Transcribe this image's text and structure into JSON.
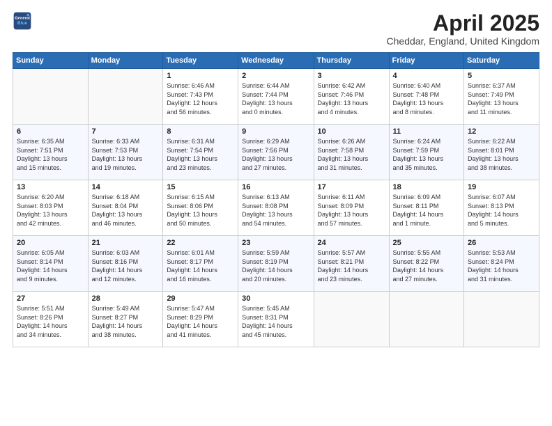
{
  "header": {
    "logo_line1": "General",
    "logo_line2": "Blue",
    "month_title": "April 2025",
    "location": "Cheddar, England, United Kingdom"
  },
  "days_of_week": [
    "Sunday",
    "Monday",
    "Tuesday",
    "Wednesday",
    "Thursday",
    "Friday",
    "Saturday"
  ],
  "weeks": [
    [
      {
        "day": "",
        "info": ""
      },
      {
        "day": "",
        "info": ""
      },
      {
        "day": "1",
        "info": "Sunrise: 6:46 AM\nSunset: 7:43 PM\nDaylight: 12 hours\nand 56 minutes."
      },
      {
        "day": "2",
        "info": "Sunrise: 6:44 AM\nSunset: 7:44 PM\nDaylight: 13 hours\nand 0 minutes."
      },
      {
        "day": "3",
        "info": "Sunrise: 6:42 AM\nSunset: 7:46 PM\nDaylight: 13 hours\nand 4 minutes."
      },
      {
        "day": "4",
        "info": "Sunrise: 6:40 AM\nSunset: 7:48 PM\nDaylight: 13 hours\nand 8 minutes."
      },
      {
        "day": "5",
        "info": "Sunrise: 6:37 AM\nSunset: 7:49 PM\nDaylight: 13 hours\nand 11 minutes."
      }
    ],
    [
      {
        "day": "6",
        "info": "Sunrise: 6:35 AM\nSunset: 7:51 PM\nDaylight: 13 hours\nand 15 minutes."
      },
      {
        "day": "7",
        "info": "Sunrise: 6:33 AM\nSunset: 7:53 PM\nDaylight: 13 hours\nand 19 minutes."
      },
      {
        "day": "8",
        "info": "Sunrise: 6:31 AM\nSunset: 7:54 PM\nDaylight: 13 hours\nand 23 minutes."
      },
      {
        "day": "9",
        "info": "Sunrise: 6:29 AM\nSunset: 7:56 PM\nDaylight: 13 hours\nand 27 minutes."
      },
      {
        "day": "10",
        "info": "Sunrise: 6:26 AM\nSunset: 7:58 PM\nDaylight: 13 hours\nand 31 minutes."
      },
      {
        "day": "11",
        "info": "Sunrise: 6:24 AM\nSunset: 7:59 PM\nDaylight: 13 hours\nand 35 minutes."
      },
      {
        "day": "12",
        "info": "Sunrise: 6:22 AM\nSunset: 8:01 PM\nDaylight: 13 hours\nand 38 minutes."
      }
    ],
    [
      {
        "day": "13",
        "info": "Sunrise: 6:20 AM\nSunset: 8:03 PM\nDaylight: 13 hours\nand 42 minutes."
      },
      {
        "day": "14",
        "info": "Sunrise: 6:18 AM\nSunset: 8:04 PM\nDaylight: 13 hours\nand 46 minutes."
      },
      {
        "day": "15",
        "info": "Sunrise: 6:15 AM\nSunset: 8:06 PM\nDaylight: 13 hours\nand 50 minutes."
      },
      {
        "day": "16",
        "info": "Sunrise: 6:13 AM\nSunset: 8:08 PM\nDaylight: 13 hours\nand 54 minutes."
      },
      {
        "day": "17",
        "info": "Sunrise: 6:11 AM\nSunset: 8:09 PM\nDaylight: 13 hours\nand 57 minutes."
      },
      {
        "day": "18",
        "info": "Sunrise: 6:09 AM\nSunset: 8:11 PM\nDaylight: 14 hours\nand 1 minute."
      },
      {
        "day": "19",
        "info": "Sunrise: 6:07 AM\nSunset: 8:13 PM\nDaylight: 14 hours\nand 5 minutes."
      }
    ],
    [
      {
        "day": "20",
        "info": "Sunrise: 6:05 AM\nSunset: 8:14 PM\nDaylight: 14 hours\nand 9 minutes."
      },
      {
        "day": "21",
        "info": "Sunrise: 6:03 AM\nSunset: 8:16 PM\nDaylight: 14 hours\nand 12 minutes."
      },
      {
        "day": "22",
        "info": "Sunrise: 6:01 AM\nSunset: 8:17 PM\nDaylight: 14 hours\nand 16 minutes."
      },
      {
        "day": "23",
        "info": "Sunrise: 5:59 AM\nSunset: 8:19 PM\nDaylight: 14 hours\nand 20 minutes."
      },
      {
        "day": "24",
        "info": "Sunrise: 5:57 AM\nSunset: 8:21 PM\nDaylight: 14 hours\nand 23 minutes."
      },
      {
        "day": "25",
        "info": "Sunrise: 5:55 AM\nSunset: 8:22 PM\nDaylight: 14 hours\nand 27 minutes."
      },
      {
        "day": "26",
        "info": "Sunrise: 5:53 AM\nSunset: 8:24 PM\nDaylight: 14 hours\nand 31 minutes."
      }
    ],
    [
      {
        "day": "27",
        "info": "Sunrise: 5:51 AM\nSunset: 8:26 PM\nDaylight: 14 hours\nand 34 minutes."
      },
      {
        "day": "28",
        "info": "Sunrise: 5:49 AM\nSunset: 8:27 PM\nDaylight: 14 hours\nand 38 minutes."
      },
      {
        "day": "29",
        "info": "Sunrise: 5:47 AM\nSunset: 8:29 PM\nDaylight: 14 hours\nand 41 minutes."
      },
      {
        "day": "30",
        "info": "Sunrise: 5:45 AM\nSunset: 8:31 PM\nDaylight: 14 hours\nand 45 minutes."
      },
      {
        "day": "",
        "info": ""
      },
      {
        "day": "",
        "info": ""
      },
      {
        "day": "",
        "info": ""
      }
    ]
  ]
}
